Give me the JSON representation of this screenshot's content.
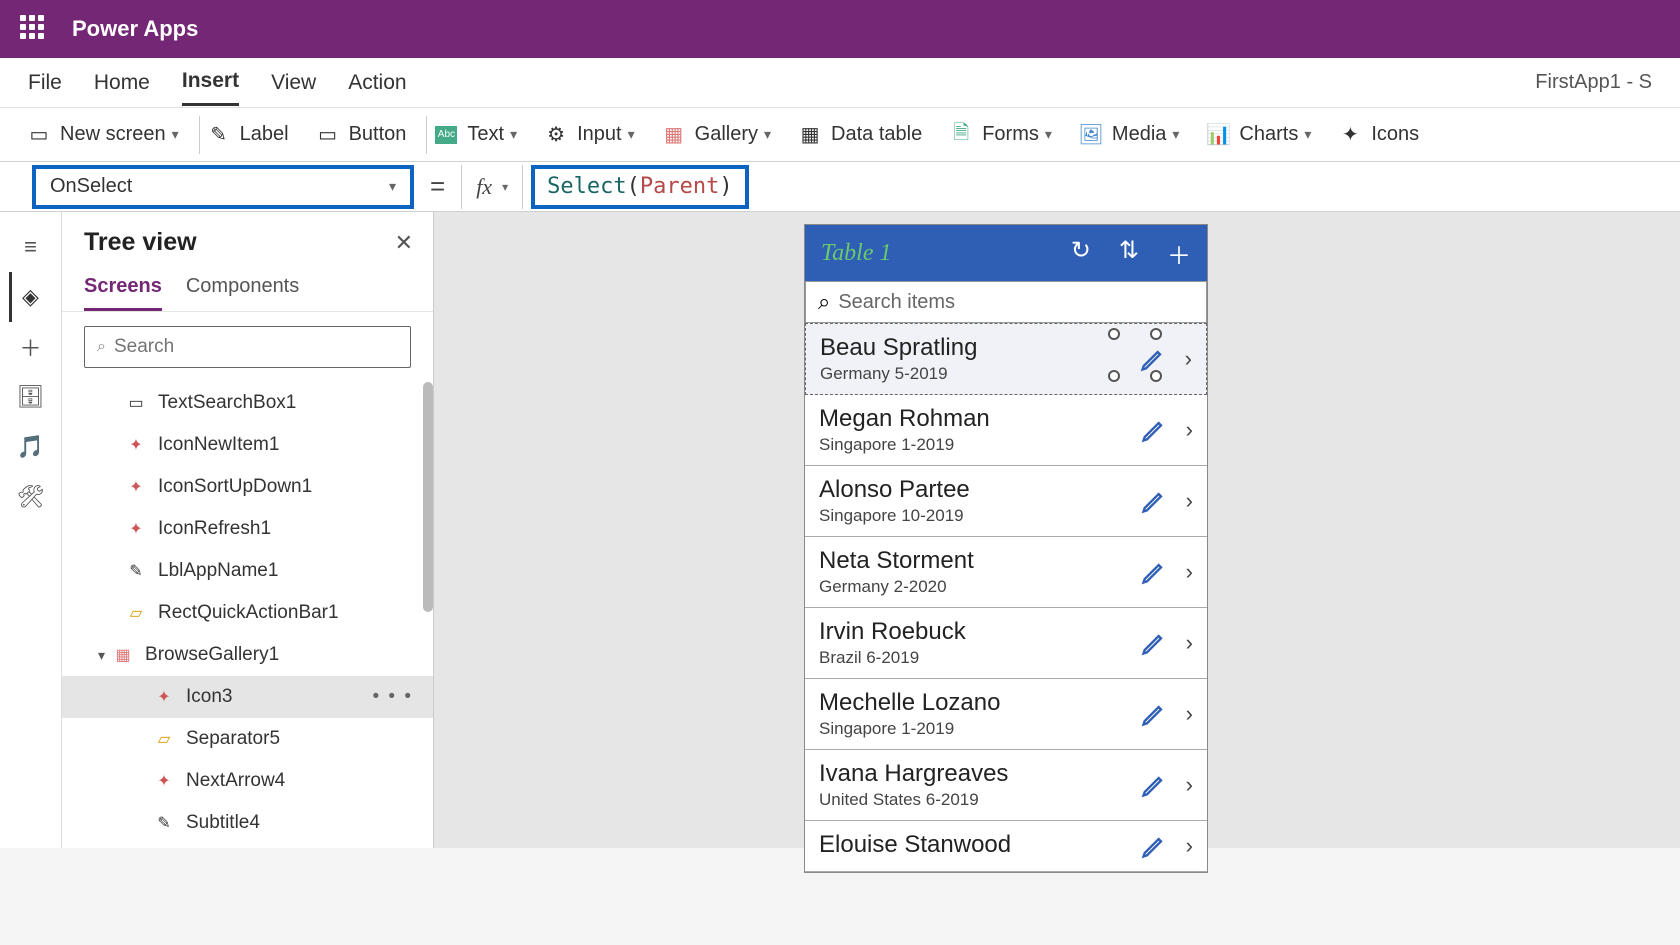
{
  "app": {
    "title": "Power Apps",
    "file_label": "FirstApp1 - S"
  },
  "menu": {
    "file": "File",
    "home": "Home",
    "insert": "Insert",
    "view": "View",
    "action": "Action"
  },
  "toolbar": {
    "new_screen": "New screen",
    "label": "Label",
    "button": "Button",
    "text": "Text",
    "input": "Input",
    "gallery": "Gallery",
    "data_table": "Data table",
    "forms": "Forms",
    "media": "Media",
    "charts": "Charts",
    "icons": "Icons"
  },
  "formula": {
    "property": "OnSelect",
    "equals": "=",
    "fx": "fx",
    "fn": "Select",
    "open": "(",
    "arg": "Parent",
    "close": ")"
  },
  "tree": {
    "title": "Tree view",
    "tabs": {
      "screens": "Screens",
      "components": "Components"
    },
    "search_placeholder": "Search",
    "items": [
      {
        "label": "TextSearchBox1"
      },
      {
        "label": "IconNewItem1"
      },
      {
        "label": "IconSortUpDown1"
      },
      {
        "label": "IconRefresh1"
      },
      {
        "label": "LblAppName1"
      },
      {
        "label": "RectQuickActionBar1"
      },
      {
        "label": "BrowseGallery1"
      },
      {
        "label": "Icon3"
      },
      {
        "label": "Separator5"
      },
      {
        "label": "NextArrow4"
      },
      {
        "label": "Subtitle4"
      }
    ]
  },
  "phone": {
    "title": "Table 1",
    "search_placeholder": "Search items",
    "list": [
      {
        "name": "Beau Spratling",
        "sub": "Germany 5-2019"
      },
      {
        "name": "Megan Rohman",
        "sub": "Singapore 1-2019"
      },
      {
        "name": "Alonso Partee",
        "sub": "Singapore 10-2019"
      },
      {
        "name": "Neta Storment",
        "sub": "Germany 2-2020"
      },
      {
        "name": "Irvin Roebuck",
        "sub": "Brazil 6-2019"
      },
      {
        "name": "Mechelle Lozano",
        "sub": "Singapore 1-2019"
      },
      {
        "name": "Ivana Hargreaves",
        "sub": "United States 6-2019"
      },
      {
        "name": "Elouise Stanwood",
        "sub": ""
      }
    ]
  }
}
